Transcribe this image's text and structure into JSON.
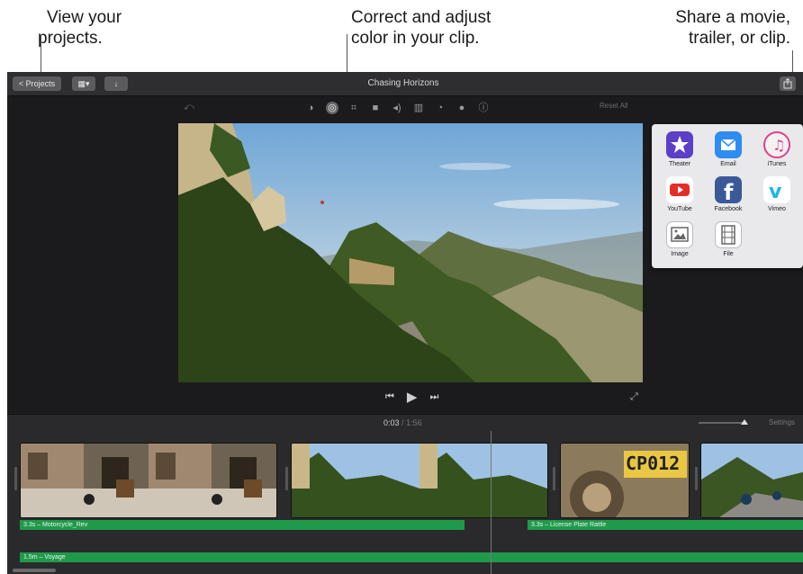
{
  "callouts": {
    "projects_line1": "View your",
    "projects_line2": "projects.",
    "color_line1": "Correct and adjust",
    "color_line2": "color in your clip.",
    "share_line1": "Share a movie,",
    "share_line2": "trailer, or clip."
  },
  "titlebar": {
    "projects_button": "< Projects",
    "title": "Chasing Horizons"
  },
  "viewer": {
    "reset_all": "Reset All",
    "toolbar_icons": [
      "color-balance-icon",
      "color-correction-icon",
      "crop-icon",
      "stabilization-icon",
      "volume-icon",
      "noise-reduction-icon",
      "speed-icon",
      "clip-filter-icon",
      "info-icon"
    ]
  },
  "share_menu": {
    "items": [
      {
        "label": "Theater",
        "icon": "theater-icon",
        "color": "#5b3fc7"
      },
      {
        "label": "Email",
        "icon": "email-icon",
        "color": "#2f8cf0"
      },
      {
        "label": "iTunes",
        "icon": "itunes-icon",
        "color": "#f2f2f2"
      },
      {
        "label": "YouTube",
        "icon": "youtube-icon",
        "color": "#ffffff"
      },
      {
        "label": "Facebook",
        "icon": "facebook-icon",
        "color": "#3b5998"
      },
      {
        "label": "Vimeo",
        "icon": "vimeo-icon",
        "color": "#ffffff"
      },
      {
        "label": "Image",
        "icon": "image-icon",
        "color": "#ffffff"
      },
      {
        "label": "File",
        "icon": "file-icon",
        "color": "#ffffff"
      }
    ]
  },
  "timeline": {
    "current_time": "0:03",
    "separator": "/",
    "total_time": "1:56",
    "settings": "Settings",
    "audio_tracks": {
      "track1": "3.3s – Motorcycle_Rev",
      "track2": "3.3s – License Plate Rattle",
      "music": "1.5m – Voyage"
    },
    "plate_text": "CP012"
  },
  "colors": {
    "audio_green": "#1f9a4a",
    "window_bg": "#1d1d1f"
  }
}
